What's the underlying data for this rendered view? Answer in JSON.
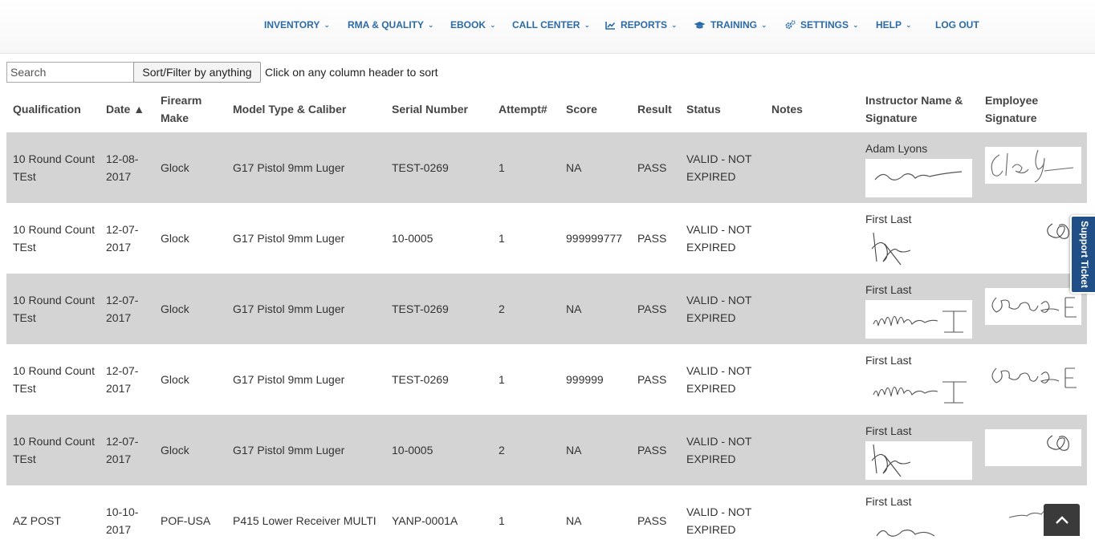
{
  "nav": {
    "items": [
      {
        "label": "INVENTORY",
        "icon": "",
        "chevron": "⌄"
      },
      {
        "label": "RMA & QUALITY",
        "icon": "",
        "chevron": "⌄"
      },
      {
        "label": "EBOOK",
        "icon": "",
        "chevron": "⌄"
      },
      {
        "label": "CALL CENTER",
        "icon": "",
        "chevron": "⌄"
      },
      {
        "label": "REPORTS",
        "icon": "line-chart-icon",
        "chevron": "⌄"
      },
      {
        "label": "TRAINING",
        "icon": "graduation-cap-icon",
        "chevron": "⌄"
      },
      {
        "label": "SETTINGS",
        "icon": "cogs-icon",
        "chevron": "⌄"
      },
      {
        "label": "HELP",
        "icon": "",
        "chevron": "⌄"
      },
      {
        "label": "LOG OUT",
        "icon": "",
        "chevron": ""
      }
    ],
    "color": "#2a6aa8"
  },
  "toolbar": {
    "search_placeholder": "Search",
    "search_value": "",
    "sort_button_label": "Sort/Filter by anything",
    "hint": "Click on any column header to sort"
  },
  "table": {
    "headers": {
      "qualification": "Qualification",
      "date": "Date ▲",
      "make": "Firearm Make",
      "model": "Model Type & Caliber",
      "serial": "Serial Number",
      "attempt": "Attempt#",
      "score": "Score",
      "result": "Result",
      "status": "Status",
      "notes": "Notes",
      "instructor": "Instructor Name & Signature",
      "employee": "Employee Signature"
    },
    "rows": [
      {
        "qualification": "10 Round Count TEst",
        "date": "12-08-2017",
        "make": "Glock",
        "model": "G17 Pistol 9mm Luger",
        "serial": "TEST-0269",
        "attempt": "1",
        "score": "NA",
        "result": "PASS",
        "status": "VALID - NOT EXPIRED",
        "notes": "",
        "instructor": "Adam Lyons"
      },
      {
        "qualification": "10 Round Count TEst",
        "date": "12-07-2017",
        "make": "Glock",
        "model": "G17 Pistol 9mm Luger",
        "serial": "10-0005",
        "attempt": "1",
        "score": "999999777",
        "result": "PASS",
        "status": "VALID - NOT EXPIRED",
        "notes": "",
        "instructor": "First Last"
      },
      {
        "qualification": "10 Round Count TEst",
        "date": "12-07-2017",
        "make": "Glock",
        "model": "G17 Pistol 9mm Luger",
        "serial": "TEST-0269",
        "attempt": "2",
        "score": "NA",
        "result": "PASS",
        "status": "VALID - NOT EXPIRED",
        "notes": "",
        "instructor": "First Last"
      },
      {
        "qualification": "10 Round Count TEst",
        "date": "12-07-2017",
        "make": "Glock",
        "model": "G17 Pistol 9mm Luger",
        "serial": "TEST-0269",
        "attempt": "1",
        "score": "999999",
        "result": "PASS",
        "status": "VALID - NOT EXPIRED",
        "notes": "",
        "instructor": "First Last"
      },
      {
        "qualification": "10 Round Count TEst",
        "date": "12-07-2017",
        "make": "Glock",
        "model": "G17 Pistol 9mm Luger",
        "serial": "10-0005",
        "attempt": "2",
        "score": "NA",
        "result": "PASS",
        "status": "VALID - NOT EXPIRED",
        "notes": "",
        "instructor": "First Last"
      },
      {
        "qualification": "AZ POST",
        "date": "10-10-2017",
        "make": "POF-USA",
        "model": "P415 Lower Receiver MULTI",
        "serial": "YANP-0001A",
        "attempt": "1",
        "score": "NA",
        "result": "PASS",
        "status": "VALID - NOT EXPIRED",
        "notes": "",
        "instructor": "First Last"
      }
    ],
    "shade_color": "#d4d4d4"
  },
  "support_tab": "Support Ticket",
  "back_to_top_icon": "chevron-up-icon"
}
